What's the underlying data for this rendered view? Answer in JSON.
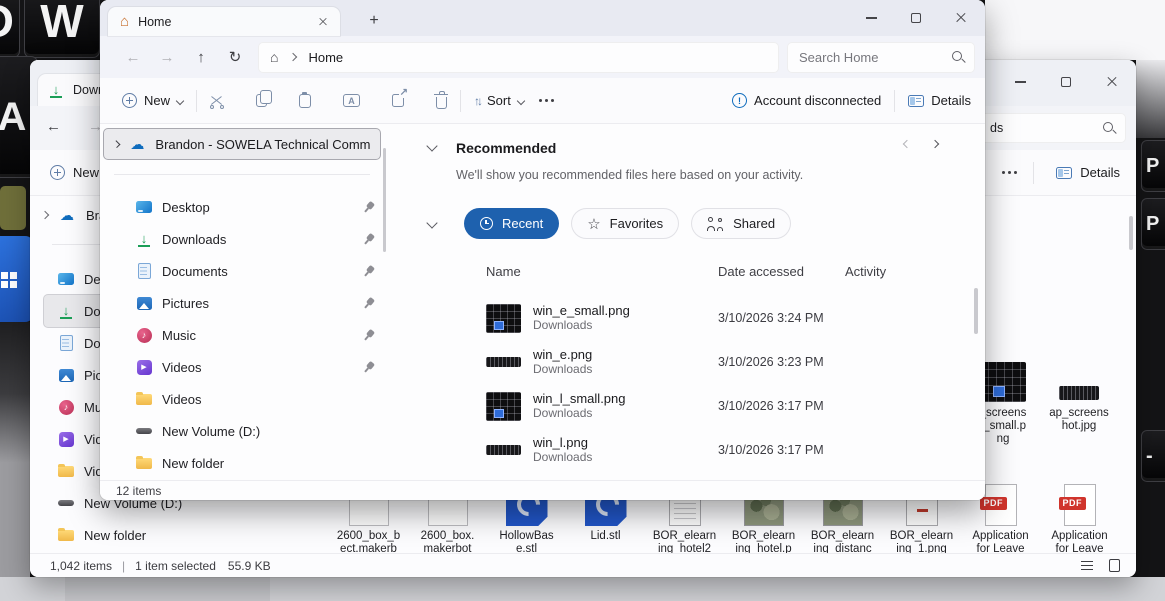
{
  "desktop": {
    "wallpaper_keys_left": [
      "D",
      "W",
      "A"
    ],
    "wallpaper_keys_right": [
      "P",
      "P",
      "-"
    ]
  },
  "front_window": {
    "tab": {
      "title": "Home"
    },
    "nav": {
      "breadcrumb_root": "Home",
      "search_placeholder": "Search Home"
    },
    "toolbar": {
      "new_label": "New",
      "sort_label": "Sort",
      "account_status": "Account disconnected",
      "details_label": "Details"
    },
    "sidebar": {
      "onedrive_label": "Brandon - SOWELA Technical Community",
      "items": [
        {
          "label": "Desktop",
          "icon": "ic-desktop",
          "pinned": true
        },
        {
          "label": "Downloads",
          "icon": "ic-downloads",
          "pinned": true
        },
        {
          "label": "Documents",
          "icon": "ic-documents",
          "pinned": true
        },
        {
          "label": "Pictures",
          "icon": "ic-pictures",
          "pinned": true
        },
        {
          "label": "Music",
          "icon": "ic-music",
          "pinned": true
        },
        {
          "label": "Videos",
          "icon": "ic-videos",
          "pinned": true
        },
        {
          "label": "Videos",
          "icon": "ic-folder",
          "pinned": false
        },
        {
          "label": "New Volume (D:)",
          "icon": "ic-drive",
          "pinned": false
        },
        {
          "label": "New folder",
          "icon": "ic-folder",
          "pinned": false
        }
      ]
    },
    "main": {
      "recommended_title": "Recommended",
      "recommended_subtitle": "We'll show you recommended files here based on your activity.",
      "filters": {
        "recent": "Recent",
        "favorites": "Favorites",
        "shared": "Shared"
      },
      "columns": {
        "name": "Name",
        "date": "Date accessed",
        "activity": "Activity"
      },
      "files": [
        {
          "name": "win_e_small.png",
          "location": "Downloads",
          "date": "3/10/2026 3:24 PM",
          "thumb": "thumb-kb"
        },
        {
          "name": "win_e.png",
          "location": "Downloads",
          "date": "3/10/2026 3:23 PM",
          "thumb": "thumb-strip"
        },
        {
          "name": "win_l_small.png",
          "location": "Downloads",
          "date": "3/10/2026 3:17 PM",
          "thumb": "thumb-kb"
        },
        {
          "name": "win_l.png",
          "location": "Downloads",
          "date": "3/10/2026 3:17 PM",
          "thumb": "thumb-strip"
        }
      ]
    },
    "status": {
      "items": "12 items"
    }
  },
  "back_window": {
    "tab": {
      "title": "Downl"
    },
    "nav": {
      "search_visible_text": "ds"
    },
    "toolbar": {
      "new_label": "New",
      "details_label": "Details"
    },
    "sidebar": {
      "onedrive_label": "Bran",
      "items": [
        {
          "label": "Desk",
          "icon": "ic-desktop",
          "state": ""
        },
        {
          "label": "Dow",
          "icon": "ic-downloads",
          "state": "selected"
        },
        {
          "label": "Docu",
          "icon": "ic-documents",
          "state": ""
        },
        {
          "label": "Pictu",
          "icon": "ic-pictures",
          "state": ""
        },
        {
          "label": "Musi",
          "icon": "ic-music",
          "state": ""
        },
        {
          "label": "Video",
          "icon": "ic-videos",
          "state": ""
        },
        {
          "label": "Video",
          "icon": "ic-folder",
          "state": ""
        },
        {
          "label": "New Volume (D:)",
          "icon": "ic-drive",
          "state": ""
        },
        {
          "label": "New folder",
          "icon": "ic-folder",
          "state": ""
        }
      ]
    },
    "grid_files": [
      {
        "line1": "2600_box_b",
        "line2": "ect.makerb",
        "thumb": "fi-blank",
        "badge": ""
      },
      {
        "line1": "2600_box.",
        "line2": "makerbot",
        "thumb": "fi-blank",
        "badge": ""
      },
      {
        "line1": "HollowBas",
        "line2": "e.stl",
        "thumb": "fi-stl",
        "badge": ""
      },
      {
        "line1": "Lid.stl",
        "line2": "",
        "thumb": "fi-stl",
        "badge": ""
      },
      {
        "line1": "BOR_elearn",
        "line2": "ing_hotel2",
        "thumb": "fi-doc",
        "badge": ""
      },
      {
        "line1": "BOR_elearn",
        "line2": "ing_hotel.p",
        "thumb": "fi-map",
        "badge": ""
      },
      {
        "line1": "BOR_elearn",
        "line2": "ing_distanc",
        "thumb": "fi-map",
        "badge": ""
      },
      {
        "line1": "BOR_elearn",
        "line2": "ing_1.png",
        "thumb": "fi-page",
        "badge": ""
      },
      {
        "line1": "Application",
        "line2": "for Leave",
        "thumb": "fi-pdf",
        "badge": "PDF"
      },
      {
        "line1": "Application",
        "line2": "for Leave",
        "thumb": "fi-pdf",
        "badge": "PDF"
      }
    ],
    "right_files": [
      {
        "line1": "_screens",
        "line2": "t_small.p",
        "line3": "ng",
        "thumb": "fi-kb"
      },
      {
        "line1": "ap_screens",
        "line2": "hot.jpg",
        "line3": "",
        "thumb": "fi-kbstrip"
      }
    ],
    "status": {
      "items": "1,042 items",
      "divider": "|",
      "selected": "1 item selected",
      "size": "55.9 KB"
    }
  }
}
